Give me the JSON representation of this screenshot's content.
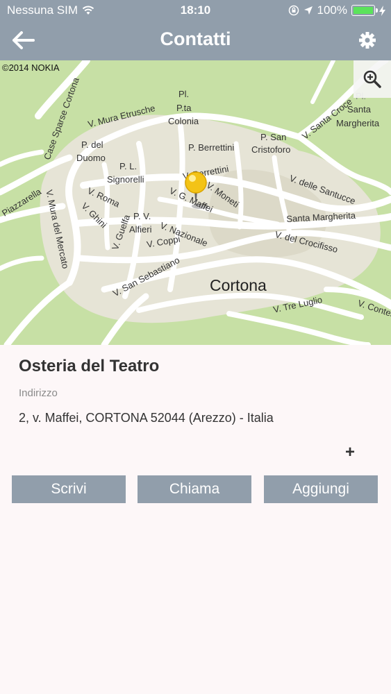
{
  "status_bar": {
    "carrier": "Nessuna SIM",
    "time": "18:10",
    "battery": "100%",
    "battery_level": 1.0,
    "battery_color": "#5be35b"
  },
  "nav": {
    "title": "Contatti",
    "back_icon": "arrow-left-icon",
    "settings_icon": "gear-icon",
    "bar_color": "#919eab"
  },
  "map": {
    "copyright": "©2014 NOKIA",
    "city": "Cortona",
    "labels": [
      "Pl.",
      "P.ta",
      "Colonia",
      "V. Mura Etrusche",
      "P. del",
      "Duomo",
      "P. Berrettini",
      "P. San",
      "Cristoforo",
      "V. Santa Croce",
      "Pl.",
      "Santa",
      "Margherita",
      "Case Sparse Cortona",
      "P. L.",
      "Signorelli",
      "V. Berrettini",
      "V. Moneti",
      "V. G. Maffei",
      "V. delle Santucce",
      "V. Roma",
      "V. Ghini",
      "P. V.",
      "Alfieri",
      "V. Nazionale",
      "Santa Margherita",
      "V. del Crocifisso",
      "Piazzarella",
      "V. Mura del Mercato",
      "V. Guelfa",
      "V. Coppi",
      "V. San Sebastiano",
      "V. Tre Luglio",
      "V. Contesse"
    ],
    "zoom_icon": "zoom-in-icon",
    "marker_icon": "map-pin-icon",
    "land_color": "#c7e0a5",
    "town_color": "#e6e4d6"
  },
  "contact": {
    "name": "Osteria del Teatro",
    "address_label": "Indirizzo",
    "address": "2, v. Maffei, CORTONA 52044 (Arezzo) - Italia",
    "more_symbol": "+"
  },
  "actions": {
    "write": "Scrivi",
    "call": "Chiama",
    "add": "Aggiungi"
  }
}
